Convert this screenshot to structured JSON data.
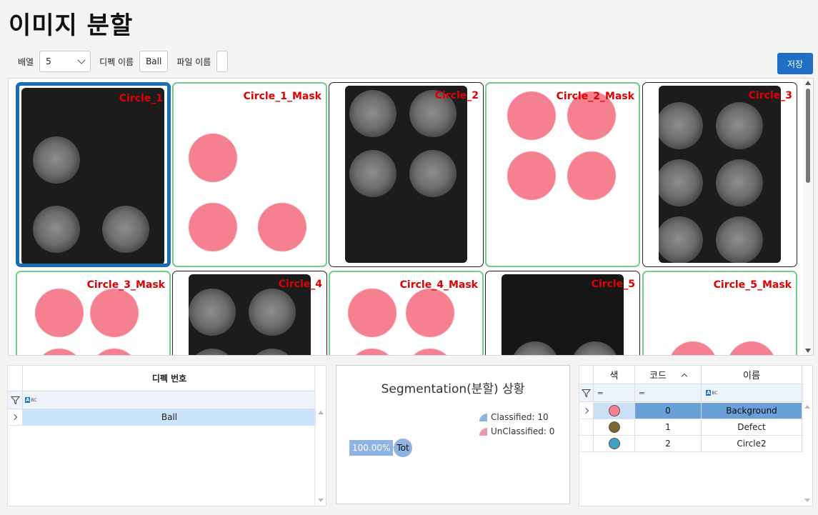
{
  "page": {
    "title": "이미지 분할"
  },
  "toolbar": {
    "layout_label": "배열",
    "layout_value": "5",
    "defect_name_label": "디펙 이름",
    "defect_name_value": "Ball",
    "file_name_label": "파일 이름",
    "file_name_value": "",
    "save_label": "저장"
  },
  "tiles": [
    {
      "label": "Circle_1",
      "kind": "image",
      "selected": true
    },
    {
      "label": "Circle_1_Mask",
      "kind": "mask"
    },
    {
      "label": "Circle_2",
      "kind": "image"
    },
    {
      "label": "Circle_2_Mask",
      "kind": "mask"
    },
    {
      "label": "Circle_3",
      "kind": "image"
    },
    {
      "label": "Circle_3_Mask",
      "kind": "mask"
    },
    {
      "label": "Circle_4",
      "kind": "image"
    },
    {
      "label": "Circle_4_Mask",
      "kind": "mask"
    },
    {
      "label": "Circle_5",
      "kind": "image"
    },
    {
      "label": "Circle_5_Mask",
      "kind": "mask"
    }
  ],
  "defect_table": {
    "header": "디펙 번호",
    "rows": [
      "Ball"
    ]
  },
  "chart_data": {
    "type": "pie",
    "title": "Segmentation(분할) 상황",
    "series": [
      {
        "name": "Classified: 10",
        "value": 10,
        "color": "#8fb4e3"
      },
      {
        "name": "UnClassified: 0",
        "value": 0,
        "color": "#e79aaa"
      }
    ],
    "center_label": "Tot",
    "percent_label": "100.00%"
  },
  "class_table": {
    "headers": {
      "color": "색",
      "code": "코드",
      "name": "이름"
    },
    "rows": [
      {
        "color": "#f5808f",
        "code": "0",
        "name": "Background"
      },
      {
        "color": "#7a6632",
        "code": "1",
        "name": "Defect"
      },
      {
        "color": "#3aa3c2",
        "code": "2",
        "name": "Circle2"
      }
    ]
  },
  "colors": {
    "accent": "#1f6fc5",
    "tile_label": "#e00000",
    "mask_border": "#6cd08a"
  }
}
